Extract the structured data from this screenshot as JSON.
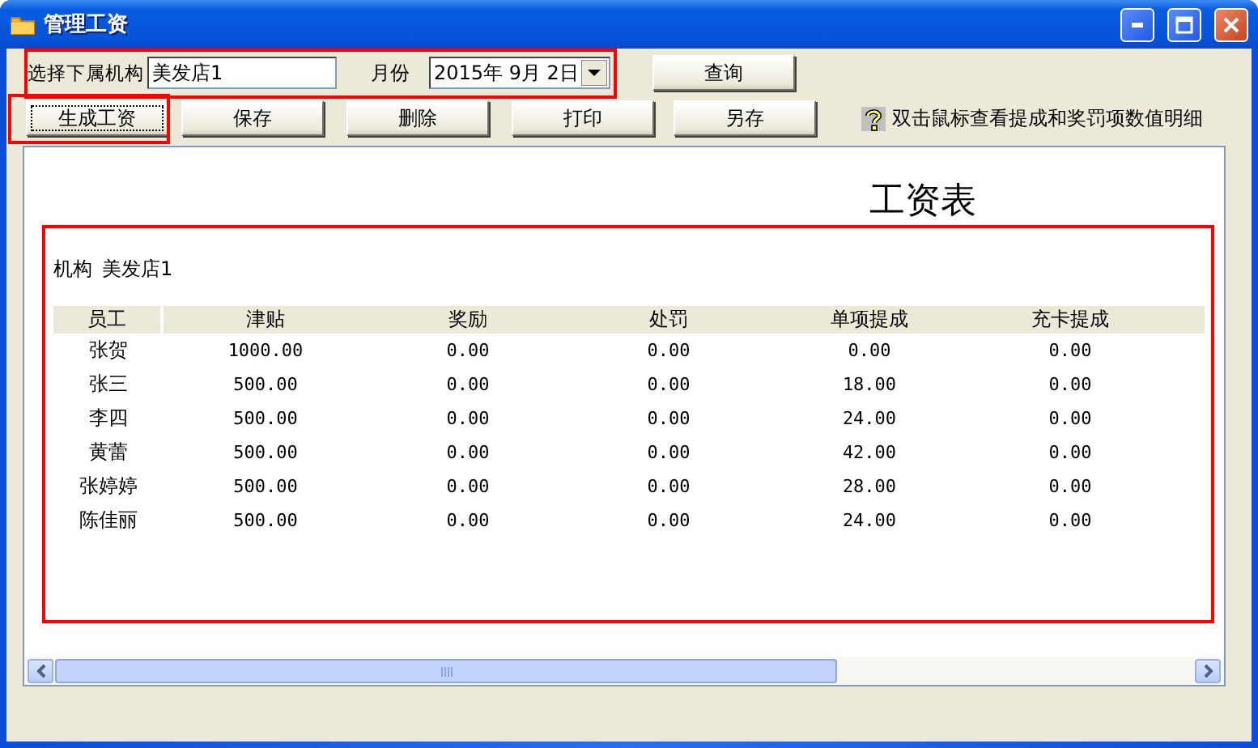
{
  "window": {
    "title": "管理工资"
  },
  "filter": {
    "org_label": "选择下属机构",
    "org_value": "美发店1",
    "month_label": "月份",
    "month_value": "2015年 9月 2日",
    "query_button": "查询"
  },
  "toolbar": [
    {
      "label": "生成工资",
      "focused": true
    },
    {
      "label": "保存",
      "focused": false
    },
    {
      "label": "删除",
      "focused": false
    },
    {
      "label": "打印",
      "focused": false
    },
    {
      "label": "另存",
      "focused": false
    }
  ],
  "hint": "双击鼠标查看提成和奖罚项数值明细",
  "report": {
    "title": "工资表",
    "org_label": "机构",
    "org_value": "美发店1",
    "columns": [
      "员工",
      "津贴",
      "奖励",
      "处罚",
      "单项提成",
      "充卡提成"
    ],
    "rows": [
      [
        "张贺",
        "1000.00",
        "0.00",
        "0.00",
        "0.00",
        "0.00"
      ],
      [
        "张三",
        "500.00",
        "0.00",
        "0.00",
        "18.00",
        "0.00"
      ],
      [
        "李四",
        "500.00",
        "0.00",
        "0.00",
        "24.00",
        "0.00"
      ],
      [
        "黄蕾",
        "500.00",
        "0.00",
        "0.00",
        "42.00",
        "0.00"
      ],
      [
        "张婷婷",
        "500.00",
        "0.00",
        "0.00",
        "28.00",
        "0.00"
      ],
      [
        "陈佳丽",
        "500.00",
        "0.00",
        "0.00",
        "24.00",
        "0.00"
      ]
    ]
  }
}
